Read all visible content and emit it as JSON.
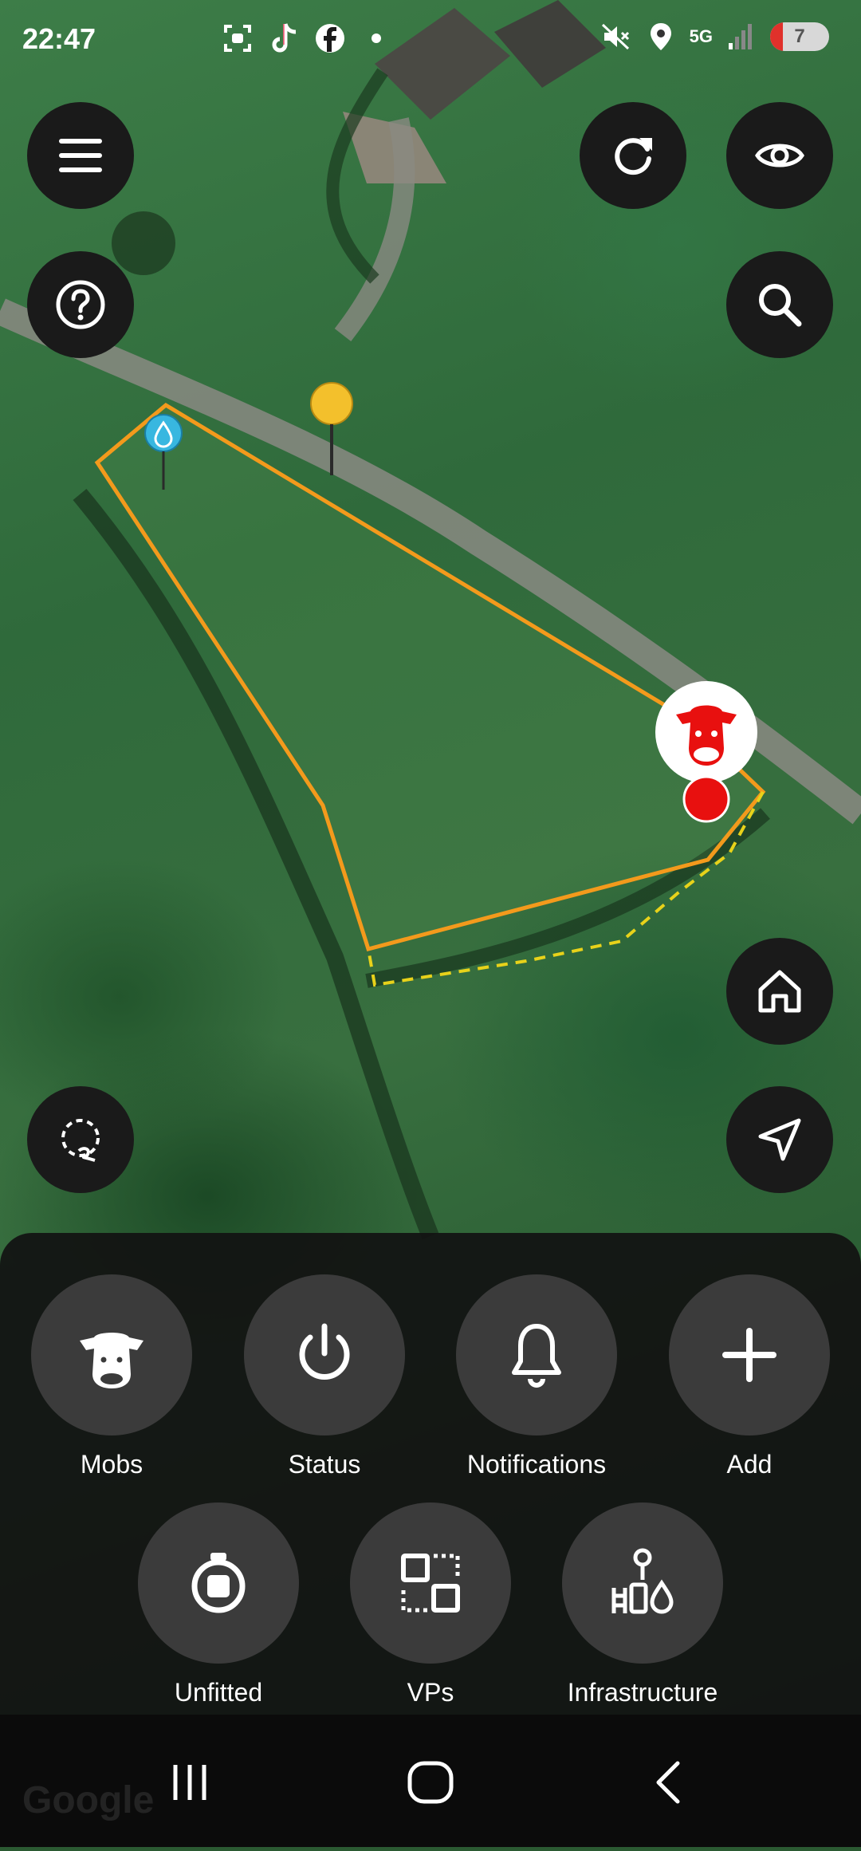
{
  "status_bar": {
    "time": "22:47",
    "network": "5G",
    "battery": "7",
    "left_icons": [
      "screenshot-icon",
      "tiktok-icon",
      "facebook-icon",
      "dot-icon"
    ],
    "right_icons": [
      "mute-icon",
      "location-icon",
      "signal-icon",
      "battery-icon"
    ]
  },
  "map": {
    "controls_left": [
      "menu-icon",
      "help-icon",
      "lasso-select-icon"
    ],
    "controls_right": [
      "refresh-icon",
      "eye-icon",
      "search-icon",
      "home-icon",
      "navigate-icon"
    ],
    "markers": [
      "yellow-pin",
      "water-pin",
      "mob-marker"
    ],
    "boundary_color": "#f39a1c",
    "dashed_boundary_color": "#e8d21a",
    "mob_marker_color": "#e8100f",
    "attribution": "Google"
  },
  "actions": {
    "row1": [
      {
        "label": "Mobs",
        "icon": "cow-icon"
      },
      {
        "label": "Status",
        "icon": "power-icon"
      },
      {
        "label": "Notifications",
        "icon": "bell-icon"
      },
      {
        "label": "Add",
        "icon": "plus-icon"
      }
    ],
    "row2": [
      {
        "label": "Unfitted",
        "icon": "collar-icon"
      },
      {
        "label": "VPs",
        "icon": "virtual-paddock-icon"
      },
      {
        "label": "Infrastructure",
        "icon": "infrastructure-icon"
      }
    ]
  },
  "navbar": [
    "recent-apps-icon",
    "home-nav-icon",
    "back-icon"
  ]
}
